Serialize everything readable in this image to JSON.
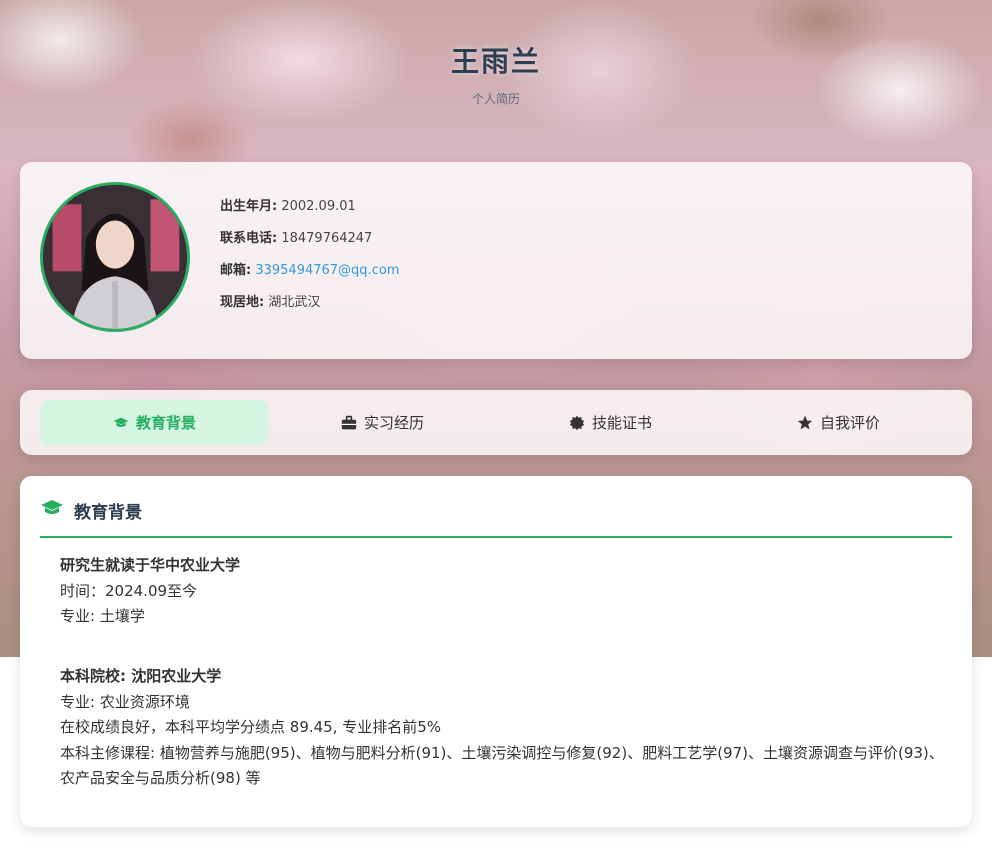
{
  "header": {
    "name": "王雨兰",
    "subtitle": "个人简历"
  },
  "profile": {
    "birth": {
      "label": "出生年月:",
      "value": "2002.09.01"
    },
    "phone": {
      "label": "联系电话:",
      "value": "18479764247"
    },
    "email": {
      "label": "邮箱:",
      "value": "3395494767@qq.com"
    },
    "location": {
      "label": "现居地:",
      "value": "湖北武汉"
    }
  },
  "tabs": [
    {
      "label": "教育背景",
      "icon": "graduation-cap-icon",
      "active": true
    },
    {
      "label": "实习经历",
      "icon": "briefcase-icon",
      "active": false
    },
    {
      "label": "技能证书",
      "icon": "certificate-icon",
      "active": false
    },
    {
      "label": "自我评价",
      "icon": "star-icon",
      "active": false
    }
  ],
  "section": {
    "title": "教育背景",
    "icon": "graduation-cap-icon",
    "graduate": {
      "school": "研究生就读于华中农业大学",
      "time": "时间：2024.09至今",
      "major": "专业: 土壤学"
    },
    "undergrad": {
      "school": "本科院校: 沈阳农业大学",
      "major": "专业: 农业资源环境",
      "gpa": "在校成绩良好，本科平均学分绩点 89.45, 专业排名前5%",
      "courses": "本科主修课程: 植物营养与施肥(95)、植物与肥料分析(91)、土壤污染调控与修复(92)、肥料工艺学(97)、土壤资源调查与评价(93)、农产品安全与品质分析(98) 等"
    }
  },
  "colors": {
    "accent": "#27ae60",
    "accent_light": "#d5f5e3",
    "link": "#3498db",
    "title": "#2c3e50"
  }
}
